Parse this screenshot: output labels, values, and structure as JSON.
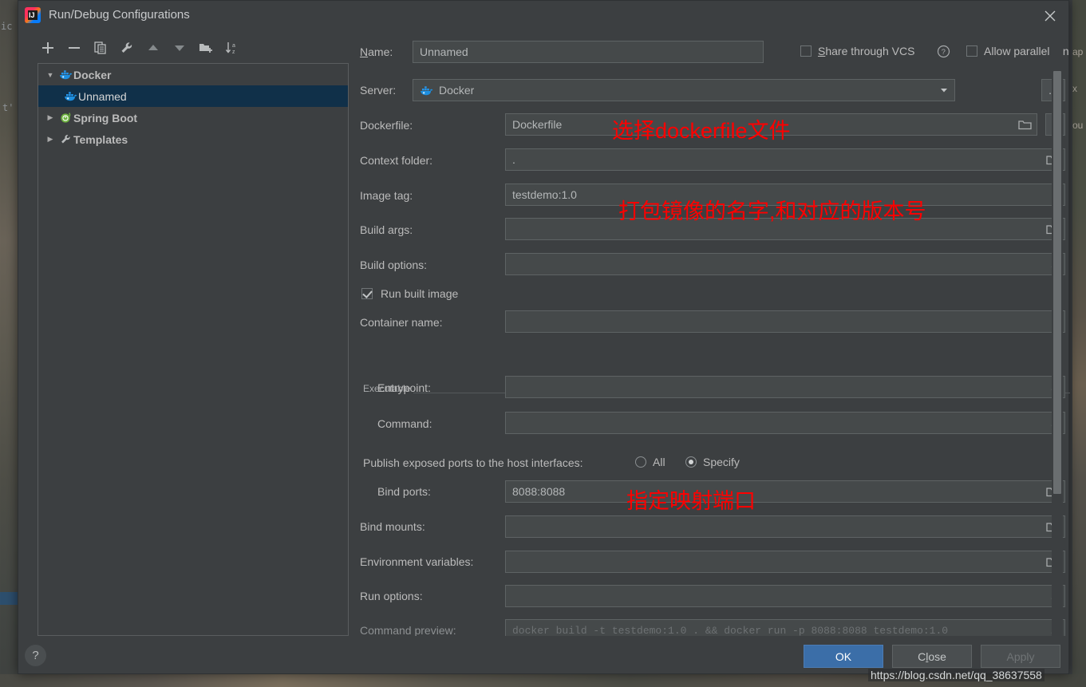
{
  "window": {
    "title": "Run/Debug Configurations",
    "app_icon": "intellij-idea-icon",
    "close_icon": "close-icon"
  },
  "toolbar": {
    "items": [
      {
        "name": "add-configuration-button",
        "icon": "plus-icon",
        "label": "+"
      },
      {
        "name": "remove-configuration-button",
        "icon": "minus-icon",
        "label": "-"
      },
      {
        "name": "copy-configuration-button",
        "icon": "copy-icon",
        "label": "Copy"
      },
      {
        "name": "edit-templates-button",
        "icon": "wrench-icon",
        "label": "Edit Templates"
      },
      {
        "name": "move-up-button",
        "icon": "arrow-up-icon",
        "label": "Move Up"
      },
      {
        "name": "move-down-button",
        "icon": "arrow-down-icon",
        "label": "Move Down"
      },
      {
        "name": "new-folder-button",
        "icon": "folder-add-icon",
        "label": "New Folder"
      },
      {
        "name": "sort-configurations-button",
        "icon": "sort-az-icon",
        "label": "Sort"
      }
    ]
  },
  "tree": {
    "nodes": [
      {
        "label": "Docker",
        "icon": "docker-icon",
        "expanded": true,
        "selected": false,
        "twisty": "▼"
      },
      {
        "label": "Unnamed",
        "icon": "docker-icon",
        "child": true,
        "selected": true,
        "twisty": ""
      },
      {
        "label": "Spring Boot",
        "icon": "spring-icon",
        "expanded": false,
        "selected": false,
        "twisty": "▶"
      },
      {
        "label": "Templates",
        "icon": "wrench-icon",
        "expanded": false,
        "selected": false,
        "twisty": "▶"
      }
    ]
  },
  "form": {
    "name_label": "Name:",
    "name_label_mnemonic": "N",
    "name_value": "Unnamed",
    "share_vcs_label": "Share through VCS",
    "share_vcs_mnemonic": "S",
    "share_vcs_checked": false,
    "help_icon": "help-icon",
    "allow_parallel_label": "Allow parallel run",
    "allow_parallel_checked": false,
    "server_label": "Server:",
    "server_value": "Docker",
    "server_icon": "docker-icon",
    "server_dropdown_icon": "chevron-down-icon",
    "server_more_label": "...",
    "dockerfile_label": "Dockerfile:",
    "dockerfile_value": "Dockerfile",
    "dockerfile_browse_icon": "folder-icon",
    "dockerfile_dropdown_icon": "chevron-down-icon",
    "context_folder_label": "Context folder:",
    "context_folder_value": ".",
    "context_folder_browse_icon": "folder-icon",
    "image_tag_label": "Image tag:",
    "image_tag_value": "testdemo:1.0",
    "build_args_label": "Build args:",
    "build_args_value": "",
    "build_args_browse_icon": "folder-icon",
    "build_options_label": "Build options:",
    "build_options_value": "",
    "build_options_expand_icon": "expand-icon",
    "run_built_image_label": "Run built image",
    "run_built_image_checked": true,
    "container_name_label": "Container name:",
    "container_name_value": "",
    "executable_group_label": "Executable",
    "entrypoint_label": "Entrypoint:",
    "entrypoint_value": "",
    "entrypoint_expand_icon": "expand-icon",
    "command_label": "Command:",
    "command_value": "",
    "command_expand_icon": "expand-icon",
    "publish_ports_label": "Publish exposed ports to the host interfaces:",
    "publish_all_label": "All",
    "publish_specify_label": "Specify",
    "publish_selected": "Specify",
    "bind_ports_label": "Bind ports:",
    "bind_ports_value": "8088:8088",
    "bind_ports_browse_icon": "folder-icon",
    "bind_mounts_label": "Bind mounts:",
    "bind_mounts_value": "",
    "bind_mounts_browse_icon": "folder-icon",
    "env_vars_label": "Environment variables:",
    "env_vars_value": "",
    "env_vars_browse_icon": "folder-icon",
    "run_options_label": "Run options:",
    "run_options_value": "",
    "run_options_expand_icon": "expand-icon",
    "command_preview_label": "Command preview:",
    "command_preview_value": "docker build -t testdemo:1.0 . && docker run -p 8088:8088 testdemo:1.0",
    "command_preview_expand_icon": "expand-icon"
  },
  "annotations": [
    {
      "text": "选择dockerfile文件",
      "color": "#ff0000"
    },
    {
      "text": "打包镜像的名字,和对应的版本号",
      "color": "#ff0000"
    },
    {
      "text": "指定映射端口",
      "color": "#ff0000"
    }
  ],
  "footer": {
    "help_label": "?",
    "ok_label": "OK",
    "close_label": "Close",
    "close_mnemonic": "l",
    "apply_label": "Apply",
    "apply_enabled": false
  },
  "watermark": {
    "text": "https://blog.csdn.net/qq_38637558"
  },
  "background": {
    "left_fragments": [
      "ic",
      "t'"
    ],
    "right_fragments": [
      "n",
      "ap",
      "x",
      "ou"
    ]
  },
  "colors": {
    "dialog_bg": "#3c3f41",
    "field_bg": "#45494a",
    "field_border": "#5e6364",
    "text": "#bbbbbb",
    "selection": "#103049",
    "accent_button": "#3b6ea8",
    "annotation": "#ff0000",
    "docker_blue": "#2496ed"
  }
}
